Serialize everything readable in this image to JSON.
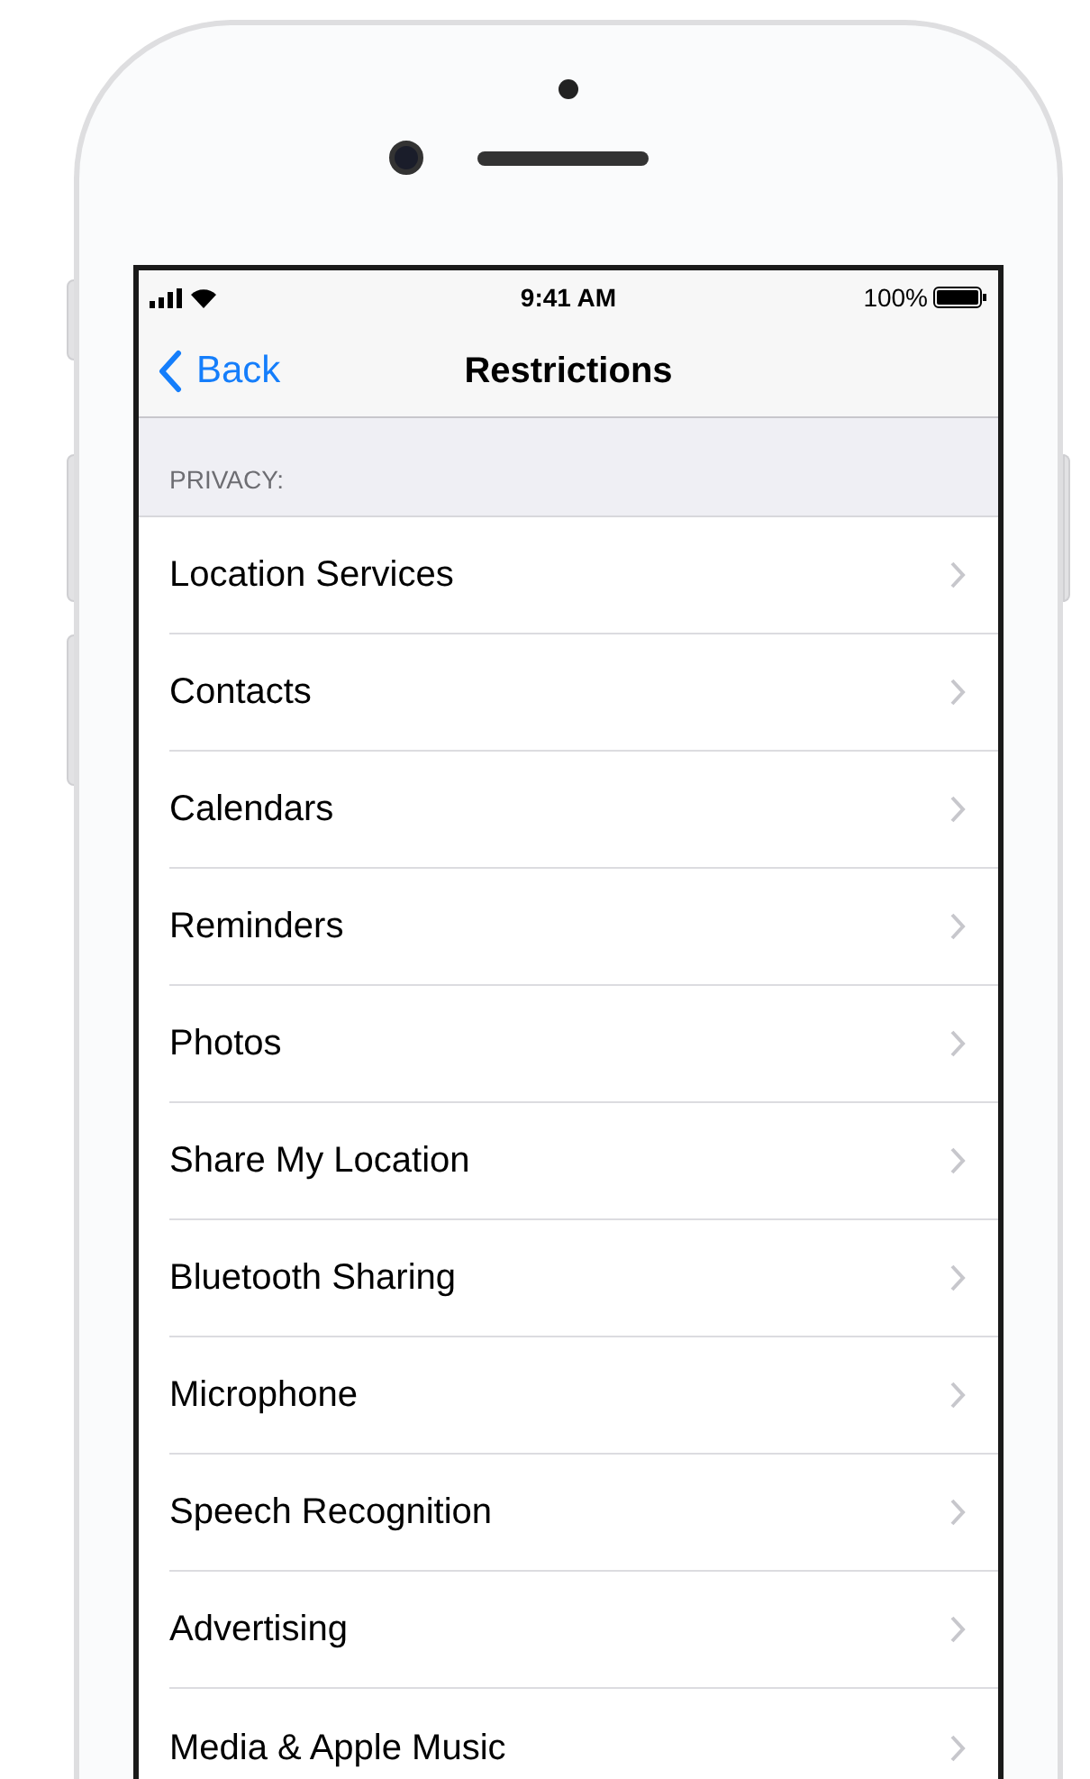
{
  "status_bar": {
    "time": "9:41 AM",
    "battery": "100%"
  },
  "nav_bar": {
    "back": "Back",
    "title": "Restrictions"
  },
  "section": {
    "header": "PRIVACY:",
    "rows": [
      {
        "label": "Location Services"
      },
      {
        "label": "Contacts"
      },
      {
        "label": "Calendars"
      },
      {
        "label": "Reminders"
      },
      {
        "label": "Photos"
      },
      {
        "label": "Share My Location"
      },
      {
        "label": "Bluetooth Sharing"
      },
      {
        "label": "Microphone"
      },
      {
        "label": "Speech Recognition"
      },
      {
        "label": "Advertising"
      },
      {
        "label": "Media & Apple Music"
      }
    ]
  }
}
